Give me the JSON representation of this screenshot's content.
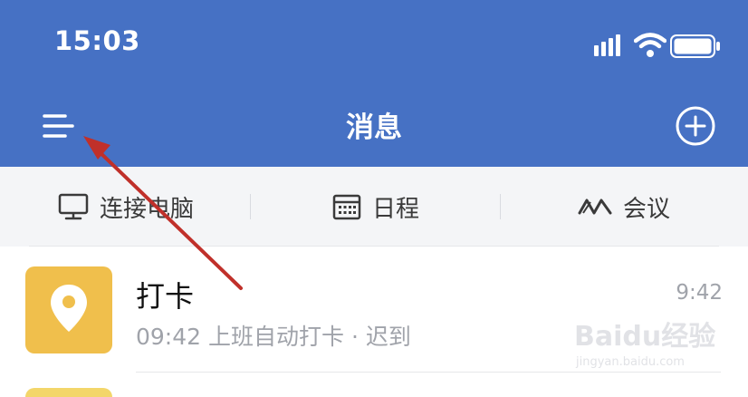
{
  "status_bar": {
    "time": "15:03",
    "icons": [
      "signal-icon",
      "wifi-icon",
      "battery-icon"
    ]
  },
  "nav": {
    "title": "消息",
    "left_icon": "menu-icon",
    "right_icon": "add-circle-icon"
  },
  "toolbar": {
    "items": [
      {
        "label": "连接电脑",
        "icon": "monitor-icon"
      },
      {
        "label": "日程",
        "icon": "calendar-icon"
      },
      {
        "label": "会议",
        "icon": "meeting-icon"
      }
    ]
  },
  "messages": [
    {
      "title": "打卡",
      "subtitle": "09:42 上班自动打卡 · 迟到",
      "time": "9:42",
      "icon": "location-pin-icon"
    }
  ],
  "watermark": {
    "line1": "Baidu经验",
    "line2": "jingyan.baidu.com"
  },
  "colors": {
    "header_bg": "#4671c4",
    "toolbar_bg": "#f4f5f7",
    "checkin_icon_bg": "#f0bf4c",
    "annotation_arrow": "#c0302a"
  }
}
